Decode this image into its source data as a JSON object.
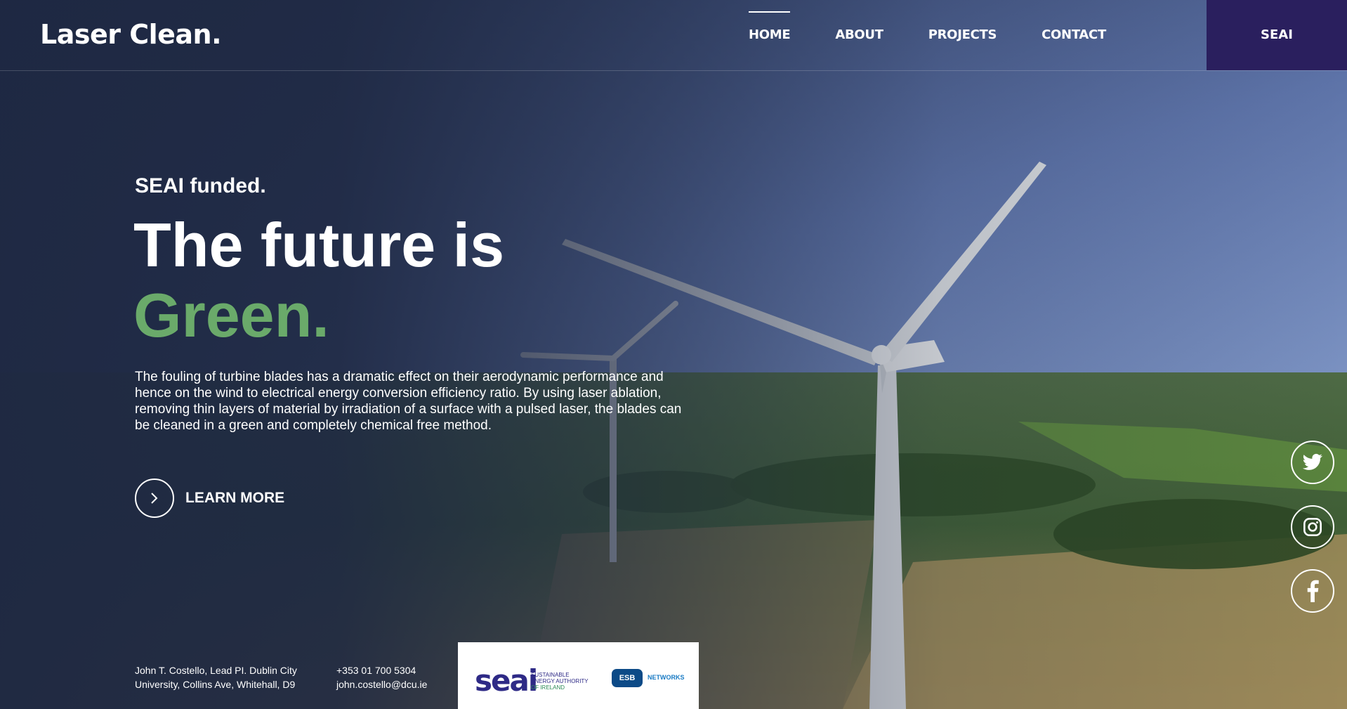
{
  "brand": {
    "logo": "Laser Clean."
  },
  "nav": {
    "items": [
      {
        "label": "HOME",
        "active": true
      },
      {
        "label": "ABOUT",
        "active": false
      },
      {
        "label": "PROJECTS",
        "active": false
      },
      {
        "label": "CONTACT",
        "active": false
      }
    ],
    "cta": "SEAI"
  },
  "hero": {
    "kicker": "SEAI funded.",
    "headline_line1": "The future is",
    "headline_line2": "Green.",
    "description": "The fouling of turbine blades has a dramatic effect on their aerodynamic performance and hence on the wind to electrical energy conversion efficiency ratio. By using laser ablation, removing thin layers of material by irradiation of a surface with a pulsed laser, the blades can be cleaned in a green and completely chemical free method.",
    "learn_more": "LEARN MORE"
  },
  "social": [
    "twitter-icon",
    "instagram-icon",
    "facebook-icon"
  ],
  "footer": {
    "address_line1": "John T. Costello, Lead PI. Dublin City",
    "address_line2": "University, Collins Ave, Whitehall, D9",
    "phone": "+353 01 700 5304",
    "email": "john.costello@dcu.ie",
    "sponsors": {
      "seai_word": "seai",
      "seai_sub1": "SUSTAINABLE",
      "seai_sub2": "ENERGY AUTHORITY",
      "seai_sub3": "OF IRELAND",
      "esb_badge": "ESB",
      "esb_networks": "NETWORKS"
    }
  },
  "colors": {
    "accent_green": "#6aaa6a",
    "cta_purple": "#2a1f5e",
    "overlay_navy": "#1f2a44"
  }
}
